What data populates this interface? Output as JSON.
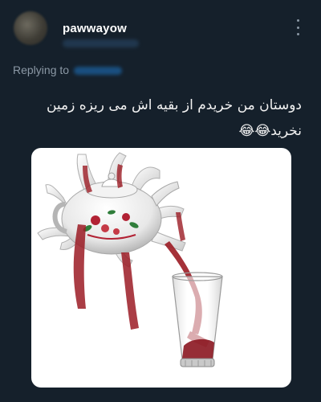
{
  "post": {
    "username": "pawwayow",
    "replying_label": "Replying to",
    "text_line1": "دوستان من خریدم از بقیه اش می ریزه زمین",
    "text_line2": "نخرید😂😂"
  },
  "icons": {
    "more": "more-vertical-icon"
  },
  "colors": {
    "background": "#15202b",
    "text": "#ffffff",
    "muted": "#8b98a5",
    "saffron": "#9b1b24"
  }
}
